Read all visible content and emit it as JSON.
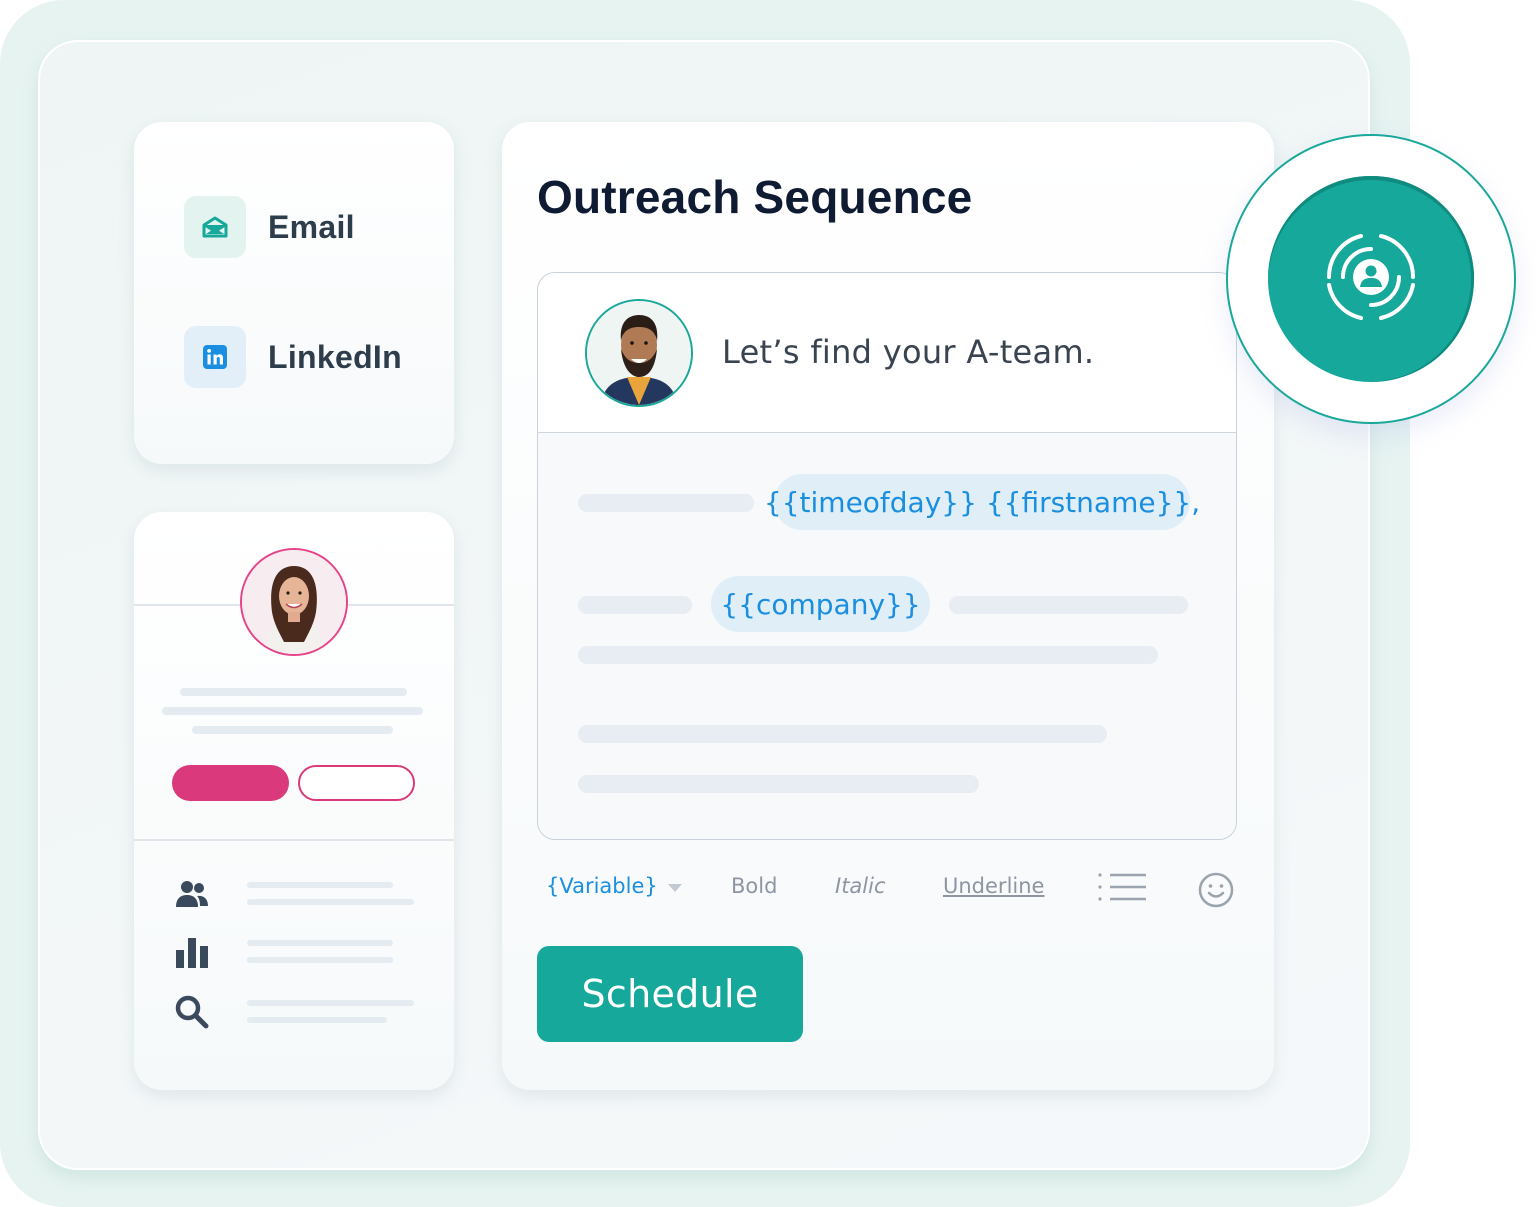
{
  "channels": {
    "items": [
      {
        "label": "Email",
        "icon": "email-open-icon"
      },
      {
        "label": "LinkedIn",
        "icon": "linkedin-icon"
      }
    ]
  },
  "profile": {
    "avatar": "woman-avatar",
    "stat_icons": [
      "people-icon",
      "bar-chart-icon",
      "search-icon"
    ]
  },
  "sequence": {
    "title": "Outreach Sequence",
    "sender_avatar": "man-avatar",
    "greeting": "Let’s find your A-team.",
    "variables": {
      "greeting_vars": "{{timeofday}} {{firstname}},",
      "company": "{{company}}"
    },
    "toolbar": {
      "variable": "{Variable}",
      "bold": "Bold",
      "italic": "Italic",
      "underline": "Underline"
    },
    "schedule_label": "Schedule"
  },
  "badge": {
    "icon": "target-user-icon"
  },
  "colors": {
    "teal": "#16a89a",
    "pink": "#da3a7c",
    "link_blue": "#1a8fe0",
    "title_navy": "#0f1a33"
  }
}
